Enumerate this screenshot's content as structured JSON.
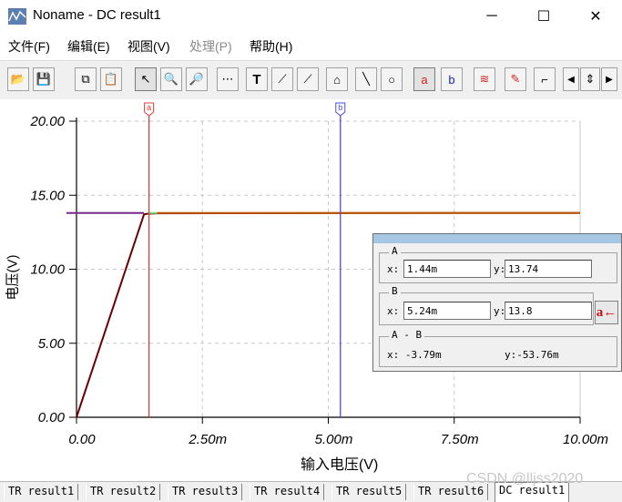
{
  "window": {
    "title": "Noname - DC result1",
    "minimize": "─",
    "maximize": "☐",
    "close": "✕"
  },
  "menu": [
    {
      "label": "文件(F)",
      "disabled": false
    },
    {
      "label": "编辑(E)",
      "disabled": false
    },
    {
      "label": "视图(V)",
      "disabled": false
    },
    {
      "label": "处理(P)",
      "disabled": true
    },
    {
      "label": "帮助(H)",
      "disabled": false
    }
  ],
  "toolbar": [
    {
      "icon": "open-folder-icon",
      "glyph": "📂"
    },
    {
      "icon": "save-icon",
      "glyph": "💾"
    },
    {
      "icon": "copy-icon",
      "glyph": "⧉"
    },
    {
      "icon": "paste-icon",
      "glyph": "📋"
    },
    {
      "icon": "pointer-icon",
      "glyph": "↖",
      "pressed": true
    },
    {
      "icon": "zoom-in-icon",
      "glyph": "🔍"
    },
    {
      "icon": "zoom-100-icon",
      "glyph": "🔎"
    },
    {
      "icon": "grid-icon",
      "glyph": "⋯"
    },
    {
      "icon": "text-icon",
      "glyph": "T"
    },
    {
      "icon": "axis-x-icon",
      "glyph": "⟋"
    },
    {
      "icon": "axis-y-icon",
      "glyph": "⟋"
    },
    {
      "icon": "axis-settings-icon",
      "glyph": "⌂"
    },
    {
      "icon": "line-icon",
      "glyph": "╲"
    },
    {
      "icon": "circle-icon",
      "glyph": "○"
    },
    {
      "icon": "cursor-a-icon",
      "glyph": "a",
      "pressed": true
    },
    {
      "icon": "cursor-b-icon",
      "glyph": "b"
    },
    {
      "icon": "add-trace-icon",
      "glyph": "≋"
    },
    {
      "icon": "probe-icon",
      "glyph": "✎"
    },
    {
      "icon": "marker-icon",
      "glyph": "⌐"
    },
    {
      "icon": "scroll-left-icon",
      "glyph": "◀"
    },
    {
      "icon": "scroll-updown-icon",
      "glyph": "⇕"
    },
    {
      "icon": "scroll-right-icon",
      "glyph": "▶"
    }
  ],
  "chart_data": {
    "type": "line",
    "xlabel": "输入电压(V)",
    "ylabel": "电压(V)",
    "x_ticks": [
      "0.00",
      "2.50m",
      "5.00m",
      "7.50m",
      "10.00m"
    ],
    "y_ticks": [
      "0.00",
      "5.00",
      "10.00",
      "15.00",
      "20.00"
    ],
    "xlim": [
      0,
      0.01
    ],
    "ylim": [
      0,
      20
    ],
    "grid": true,
    "series": [
      {
        "color": "#6b0000",
        "x": [
          0,
          0.00134,
          0.0014,
          0.0016,
          0.01
        ],
        "y": [
          0,
          13.7,
          13.75,
          13.78,
          13.8
        ]
      },
      {
        "color": "#c25a00",
        "x": [
          0.0016,
          0.01
        ],
        "y": [
          13.8,
          13.8
        ]
      },
      {
        "color": "#7a2a8a",
        "x": [
          -0.0002,
          0.00134
        ],
        "y": [
          13.8,
          13.8
        ]
      },
      {
        "color": "#7fe07f",
        "x": [
          0.00142,
          0.0016
        ],
        "y": [
          13.8,
          13.8
        ]
      }
    ],
    "cursors": [
      {
        "label": "a",
        "x": 0.00144,
        "color": "#e23b3b"
      },
      {
        "label": "b",
        "x": 0.00524,
        "color": "#4a4ae6"
      }
    ]
  },
  "readout": {
    "a_title": "A",
    "b_title": "B",
    "diff_title": "A - B",
    "x_label": "x:",
    "y_label": "y:",
    "a_x": "1.44m",
    "a_y": "13.74",
    "b_x": "5.24m",
    "b_y": "13.8",
    "diff_x": "x: -3.79m",
    "diff_y": "y:-53.76m",
    "swap_glyph": "a←"
  },
  "tabs": [
    {
      "label": "TR result1",
      "active": false
    },
    {
      "label": "TR result2",
      "active": false
    },
    {
      "label": "TR result3",
      "active": false
    },
    {
      "label": "TR result4",
      "active": false
    },
    {
      "label": "TR result5",
      "active": false
    },
    {
      "label": "TR result6",
      "active": false
    },
    {
      "label": "DC result1",
      "active": true
    }
  ],
  "watermark": "CSDN @lljss2020",
  "colors": {
    "grid": "#c8c8c8",
    "axis": "#000000",
    "cursor_a": "#e23b3b",
    "cursor_b": "#4a4ae6"
  }
}
